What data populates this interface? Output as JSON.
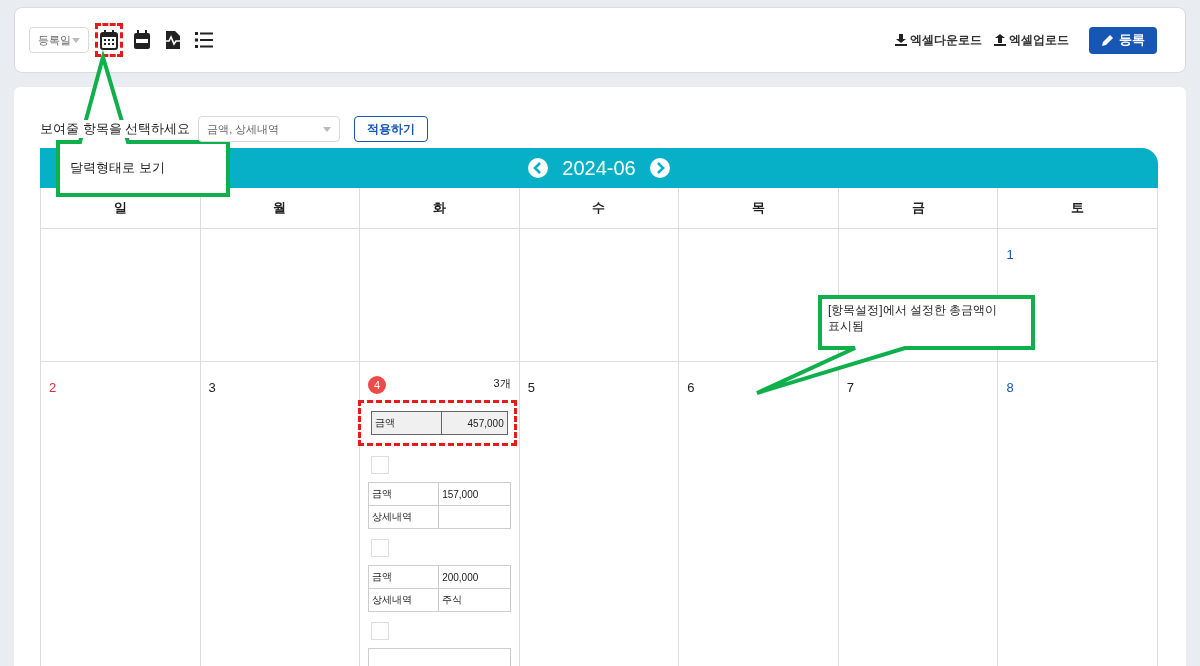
{
  "toolbar": {
    "date_filter": {
      "value": "등록일"
    },
    "view_icons": [
      {
        "kind": "calendar",
        "highlighted": true
      },
      {
        "kind": "calendar-bar",
        "highlighted": false
      },
      {
        "kind": "file",
        "highlighted": false
      },
      {
        "kind": "list",
        "highlighted": false
      }
    ],
    "actions": [
      {
        "kind": "download",
        "label": "엑셀다운로드"
      },
      {
        "kind": "upload",
        "label": "엑셀업로드"
      }
    ],
    "register_button": {
      "label": "등록"
    }
  },
  "field_picker": {
    "label": "보여줄 항목을 선택하세요",
    "value": "금액, 상세내역",
    "apply_button": "적용하기"
  },
  "calendar": {
    "month": "2024-06",
    "weekdays": [
      "일",
      "월",
      "화",
      "수",
      "목",
      "금",
      "토"
    ],
    "weeks": [
      [
        {
          "day": "1"
        }
      ],
      [
        {
          "day": "2"
        },
        {
          "day": "3"
        },
        {
          "day": "4",
          "marked": true,
          "count": "3개",
          "total": {
            "label": "금액",
            "value": "457,000",
            "highlighted": true
          },
          "entries": [
            {
              "checked": false,
              "rows": [
                {
                  "label": "금액",
                  "value": "157,000"
                },
                {
                  "label": "상세내역"
                }
              ]
            },
            {
              "checked": false,
              "rows": [
                {
                  "label": "금액",
                  "value": "200,000"
                },
                {
                  "label": "상세내역",
                  "value": "주식"
                }
              ]
            },
            {
              "checked": false
            }
          ]
        },
        {
          "day": "5"
        },
        {
          "day": "6"
        },
        {
          "day": "7"
        },
        {
          "day": "8"
        }
      ]
    ]
  },
  "callouts": [
    {
      "text": "달력형태로 보기"
    },
    {
      "text": "[항목설정]에서 설정한 총금액이 표시됨"
    }
  ]
}
